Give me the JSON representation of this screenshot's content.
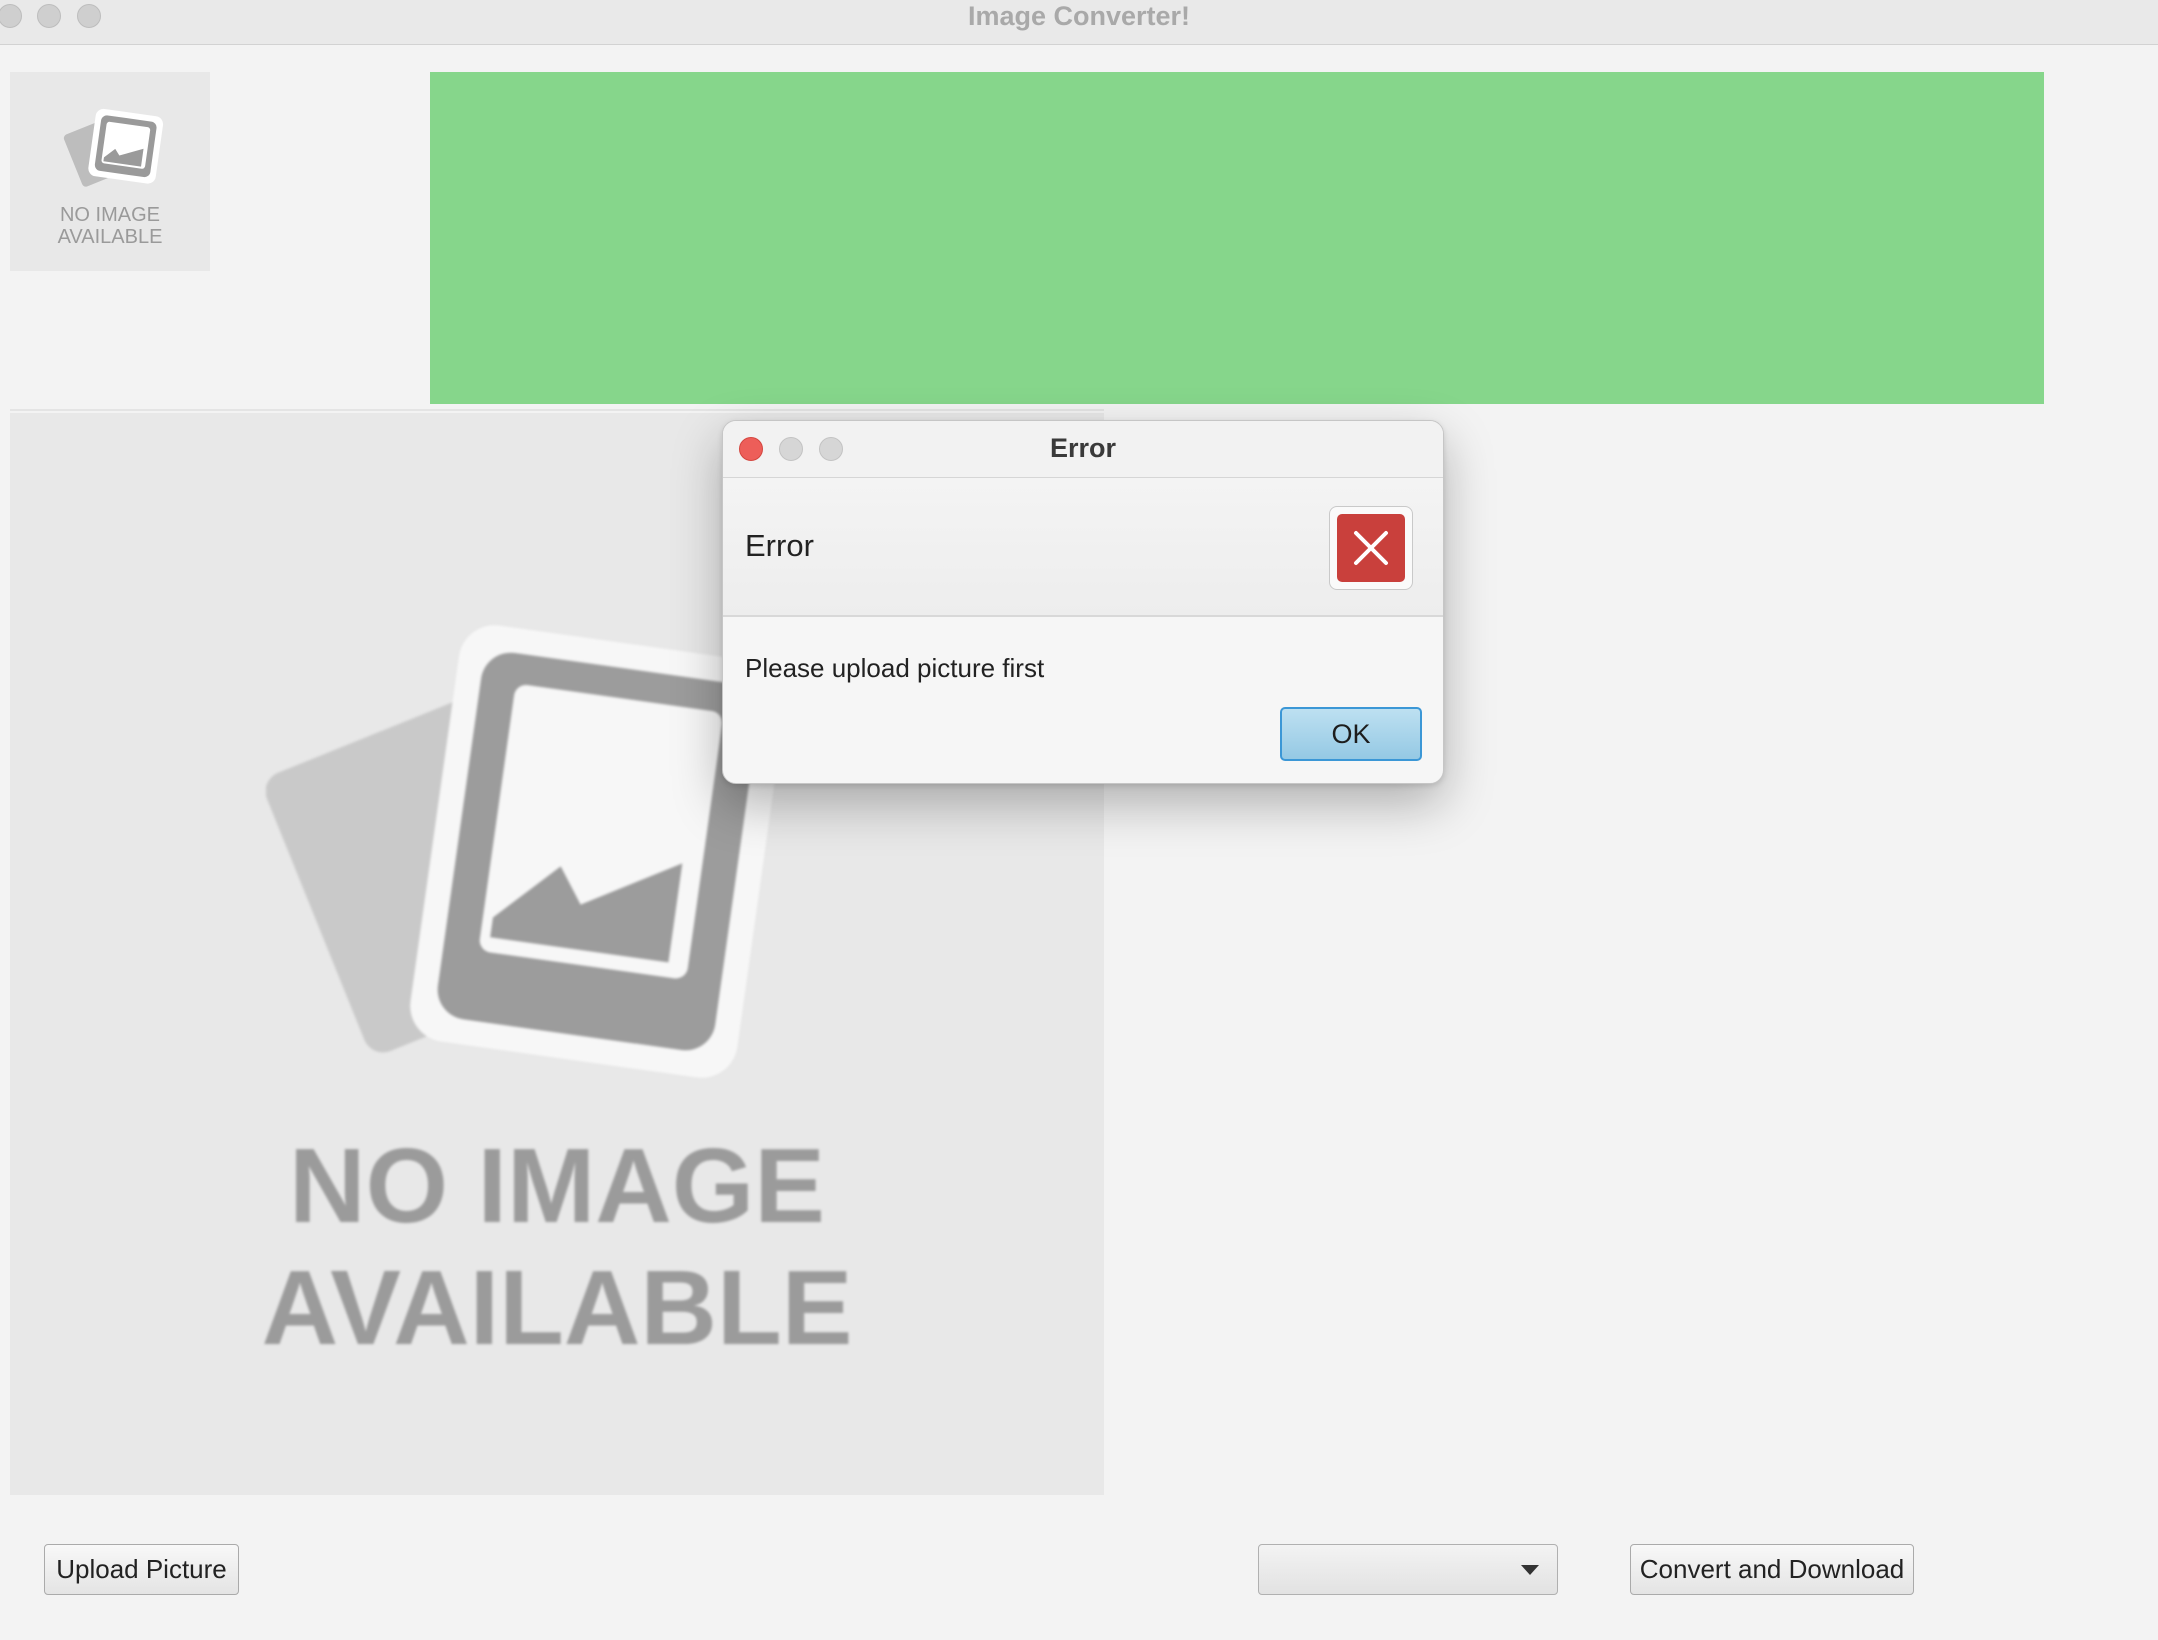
{
  "window": {
    "title": "Image Converter!"
  },
  "thumbnail": {
    "placeholder_text": "NO IMAGE\nAVAILABLE",
    "icon": "image-placeholder-icon"
  },
  "banner": {
    "color": "#86d68b"
  },
  "preview": {
    "placeholder_text": "NO IMAGE\nAVAILABLE",
    "icon": "image-placeholder-icon"
  },
  "toolbar": {
    "upload_label": "Upload Picture",
    "format_select_value": "",
    "convert_label": "Convert and Download"
  },
  "dialog": {
    "title": "Error",
    "header": "Error",
    "message": "Please upload picture first",
    "ok_label": "OK",
    "icon": "error-x-icon",
    "icon_color": "#c9403c"
  }
}
